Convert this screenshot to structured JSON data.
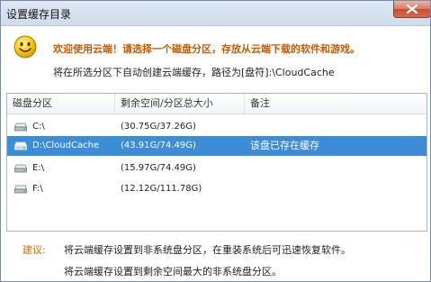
{
  "window": {
    "title": "设置缓存目录"
  },
  "header": {
    "welcome": "欢迎使用云端！请选择一个磁盘分区，存放从云端下载的软件和游戏。",
    "path_note": "将在所选分区下自动创建云端缓存，路径为[盘符]:\\CloudCache"
  },
  "list": {
    "columns": [
      "磁盘分区",
      "剩余空间/分区总大小",
      "备注"
    ],
    "rows": [
      {
        "drive": "C:\\",
        "space": "(30.75G/37.26G)",
        "note": "",
        "selected": false
      },
      {
        "drive": "D:\\CloudCache",
        "space": "(43.91G/74.49G)",
        "note": "该盘已存在缓存",
        "selected": true
      },
      {
        "drive": "E:\\",
        "space": "(15.97G/74.49G)",
        "note": "",
        "selected": false
      },
      {
        "drive": "F:\\",
        "space": "(12.12G/111.78G)",
        "note": "",
        "selected": false
      }
    ]
  },
  "tips": {
    "label": "建议:",
    "lines": [
      "将云端缓存设置到非系统盘分区，在重装系统后可迅速恢复软件。",
      "将云端缓存设置到剩余空间最大的非系统盘分区。"
    ]
  },
  "icons": {
    "close": "close-icon",
    "smiley": "smiley-icon",
    "drive": "hard-drive-icon"
  },
  "colors": {
    "accent_orange": "#c85a00",
    "selection_blue": "#3d8cd8"
  }
}
